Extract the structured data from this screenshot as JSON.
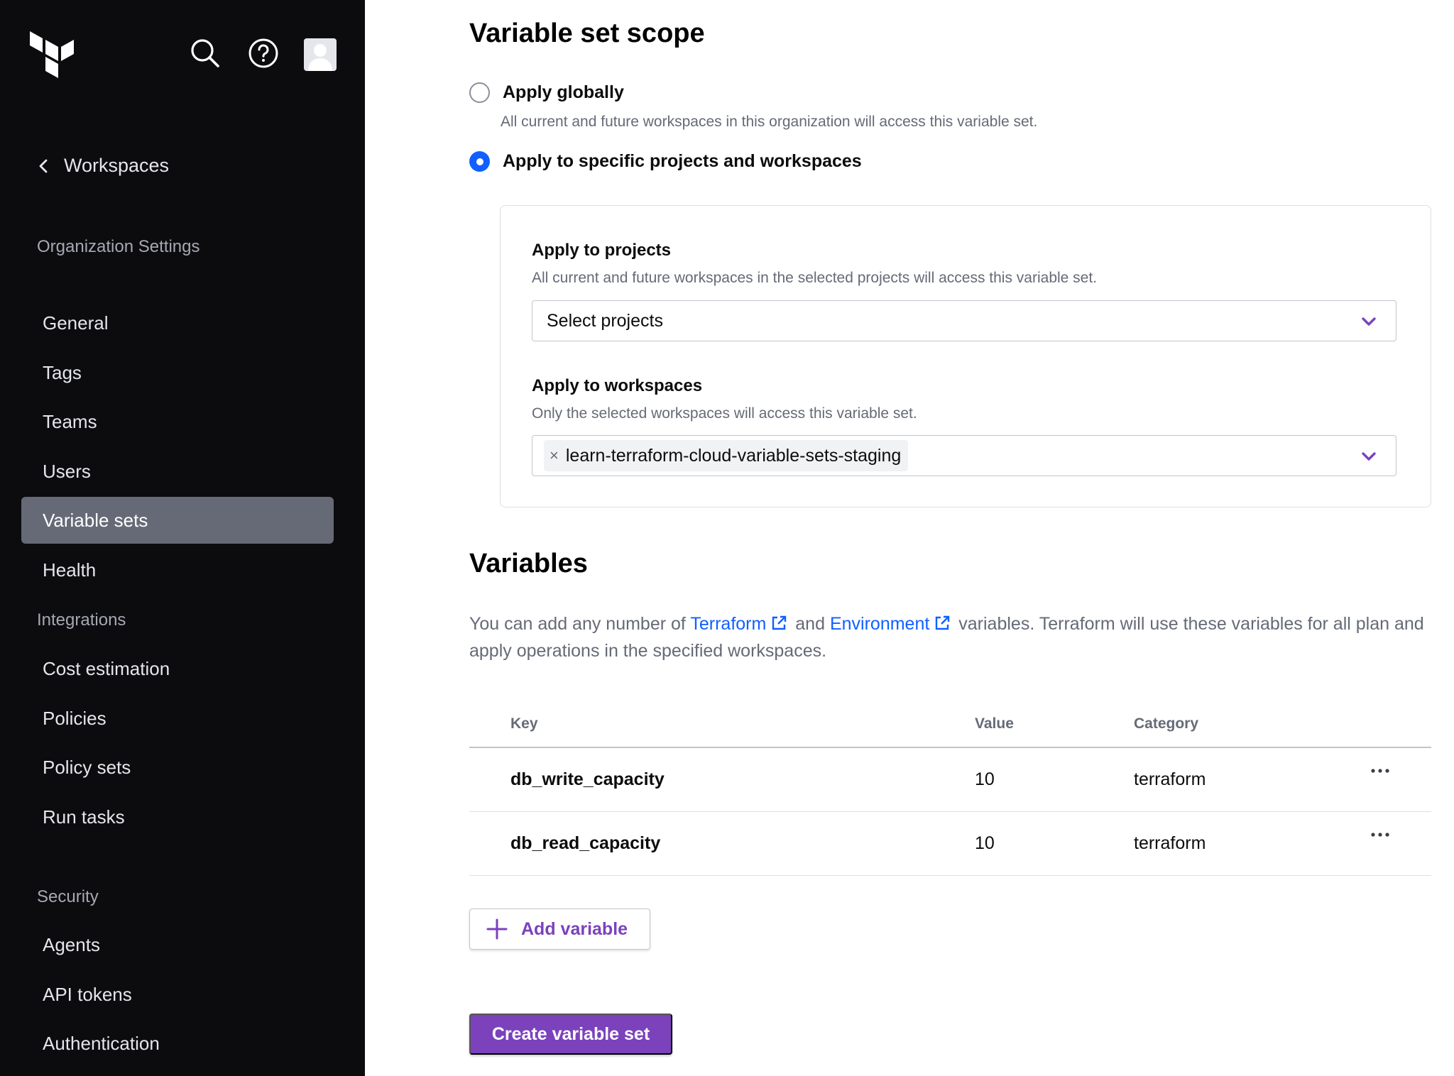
{
  "colors": {
    "sidebar_bg": "#0c0c0e",
    "active_nav_bg": "#656a76",
    "brand_purple": "#7b42bc",
    "link_blue": "#1060ff"
  },
  "sidebar": {
    "back_label": "Workspaces",
    "section_org": "Organization Settings",
    "items_org": [
      "General",
      "Tags",
      "Teams",
      "Users",
      "Variable sets",
      "Health"
    ],
    "section_integrations": "Integrations",
    "items_integrations": [
      "Cost estimation",
      "Policies",
      "Policy sets",
      "Run tasks"
    ],
    "section_security": "Security",
    "items_security": [
      "Agents",
      "API tokens",
      "Authentication"
    ],
    "active_item": "Variable sets"
  },
  "scope": {
    "title": "Variable set scope",
    "option_global": {
      "label": "Apply globally",
      "help": "All current and future workspaces in this organization will access this variable set.",
      "checked": false
    },
    "option_specific": {
      "label": "Apply to specific projects and workspaces",
      "checked": true
    },
    "projects": {
      "label": "Apply to projects",
      "help": "All current and future workspaces in the selected projects will access this variable set.",
      "placeholder": "Select projects"
    },
    "workspaces": {
      "label": "Apply to workspaces",
      "help": "Only the selected workspaces will access this variable set.",
      "selected_chip": "learn-terraform-cloud-variable-sets-staging",
      "chip_remove": "×"
    }
  },
  "variables": {
    "title": "Variables",
    "desc_pre": "You can add any number of",
    "link_terraform": "Terraform",
    "desc_and": "and",
    "link_environment": "Environment",
    "desc_post": "variables. Terraform will use these variables for all plan and apply operations in the specified workspaces.",
    "columns": {
      "key": "Key",
      "value": "Value",
      "category": "Category"
    },
    "rows": [
      {
        "key": "db_write_capacity",
        "value": "10",
        "category": "terraform"
      },
      {
        "key": "db_read_capacity",
        "value": "10",
        "category": "terraform"
      }
    ],
    "add_label": "Add variable"
  },
  "create_label": "Create variable set"
}
